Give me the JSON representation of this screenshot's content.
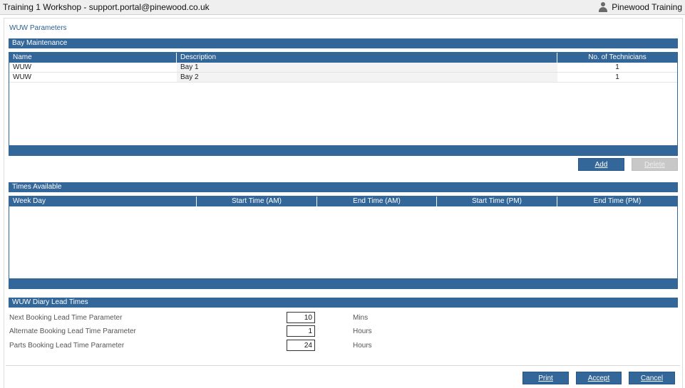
{
  "window": {
    "title": "Training 1 Workshop - support.portal@pinewood.co.uk",
    "user": "Pinewood Training"
  },
  "page_title": "WUW Parameters",
  "bay_maintenance": {
    "heading": "Bay Maintenance",
    "columns": [
      "Name",
      "Description",
      "No. of Technicians"
    ],
    "rows": [
      {
        "name": "WUW",
        "description": "Bay 1",
        "technicians": "1"
      },
      {
        "name": "WUW",
        "description": "Bay 2",
        "technicians": "1"
      }
    ],
    "add_label": "Add",
    "delete_label": "Delete"
  },
  "times_available": {
    "heading": "Times Available",
    "columns": [
      "Week Day",
      "Start Time (AM)",
      "End Time (AM)",
      "Start Time (PM)",
      "End Time (PM)"
    ]
  },
  "lead_times": {
    "heading": "WUW Diary Lead Times",
    "fields": [
      {
        "label": "Next Booking Lead Time Parameter",
        "value": "10",
        "unit": "Mins"
      },
      {
        "label": "Alternate Booking Lead Time Parameter",
        "value": "1",
        "unit": "Hours"
      },
      {
        "label": "Parts Booking Lead Time Parameter",
        "value": "24",
        "unit": "Hours"
      }
    ]
  },
  "footer": {
    "print_label": "Print",
    "accept_label": "Accept",
    "cancel_label": "Cancel"
  }
}
